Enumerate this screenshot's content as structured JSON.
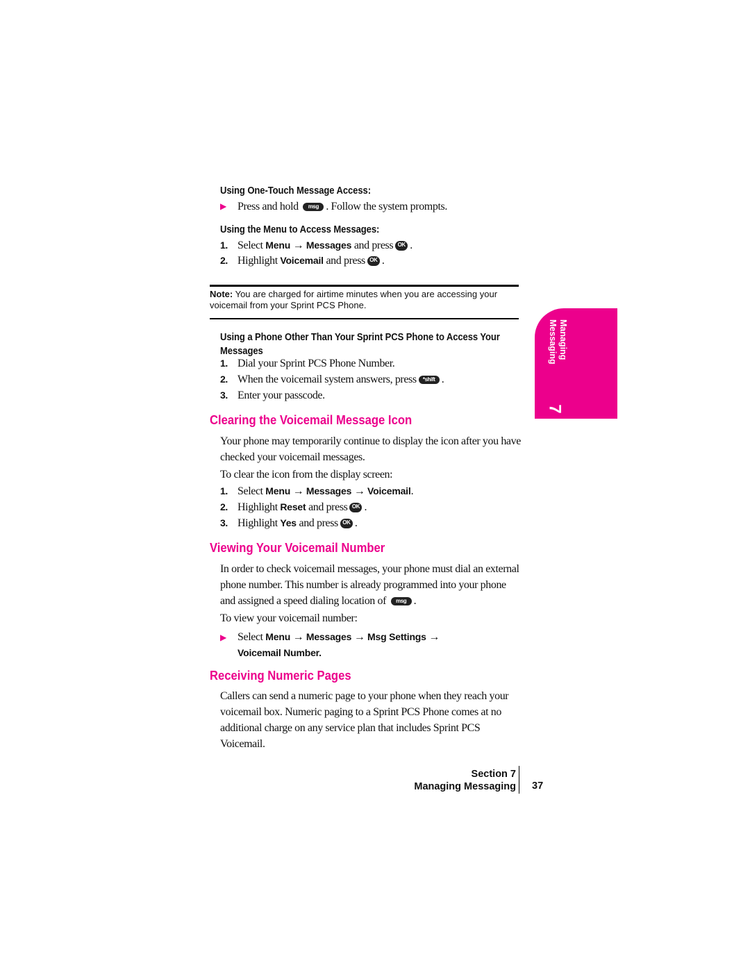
{
  "one_touch": {
    "heading": "Using One-Touch Message Access:",
    "line_a": "Press and hold",
    "key": "msg",
    "line_b": ". Follow the system prompts."
  },
  "menu_access": {
    "heading": "Using the Menu to Access Messages:",
    "steps": [
      {
        "n": "1.",
        "a": "Select ",
        "b1": "Menu",
        "arrow": " → ",
        "b2": "Messages",
        "c": " and press",
        "key": "OK",
        "d": "."
      },
      {
        "n": "2.",
        "a": "Highlight ",
        "b1": "Voicemail",
        "c": " and press",
        "key": "OK",
        "d": "."
      }
    ]
  },
  "note": {
    "label": "Note:",
    "text": " You are charged for airtime minutes when you are accessing your",
    "text2": "voicemail from your Sprint PCS Phone."
  },
  "other_phone": {
    "heading": "Using a Phone Other Than Your Sprint PCS Phone to Access Your",
    "heading2": "Messages",
    "steps": [
      {
        "n": "1.",
        "text": "Dial your Sprint PCS Phone Number."
      },
      {
        "n": "2.",
        "text": "When the voicemail system answers, press",
        "key": "*shift",
        "end": "."
      },
      {
        "n": "3.",
        "text": "Enter your passcode."
      }
    ]
  },
  "clearing": {
    "title": "Clearing the Voicemail Message Icon",
    "p1": "Your phone may temporarily continue to display the icon after you have",
    "p1b": "checked your voicemail messages.",
    "p2": "To clear the icon from the display screen:",
    "step1": {
      "n": "1.",
      "a": "Select ",
      "b1": "Menu",
      "b2": "Messages",
      "b3": "Voicemail",
      "arrow": " → ",
      "d": "."
    },
    "step2": {
      "n": "2.",
      "a": "Highlight ",
      "b": "Reset",
      "c": " and press",
      "key": "OK",
      "d": "."
    },
    "step3": {
      "n": "3.",
      "a": "Highlight ",
      "b": "Yes",
      "c": " and press",
      "key": "OK",
      "d": "."
    }
  },
  "viewing": {
    "title": "Viewing Your Voicemail Number",
    "p1": "In order to check voicemail messages, your phone must dial an external",
    "p1b": "phone number. This number is already programmed into your phone",
    "p1c": "and assigned a speed dialing location of",
    "key": "msg",
    "p1d": ".",
    "p2": "To view your voicemail number:",
    "a": "Select ",
    "b1": "Menu",
    "b2": "Messages",
    "b3": "Msg Settings",
    "b4": "Voicemail Number.",
    "arrow": " → "
  },
  "receiving": {
    "title": "Receiving Numeric Pages",
    "lines": [
      "Callers can send a numeric page to your phone when they reach your",
      "voicemail box. Numeric paging to a Sprint PCS Phone comes at no",
      "additional charge on any service plan that includes Sprint PCS",
      "Voicemail."
    ]
  },
  "tab": {
    "line1": "Managing",
    "line2": "Messaging",
    "number": "7",
    "color": "#ec008c"
  },
  "footer": {
    "section": "Section 7",
    "chapter": "Managing Messaging",
    "page": "37"
  }
}
